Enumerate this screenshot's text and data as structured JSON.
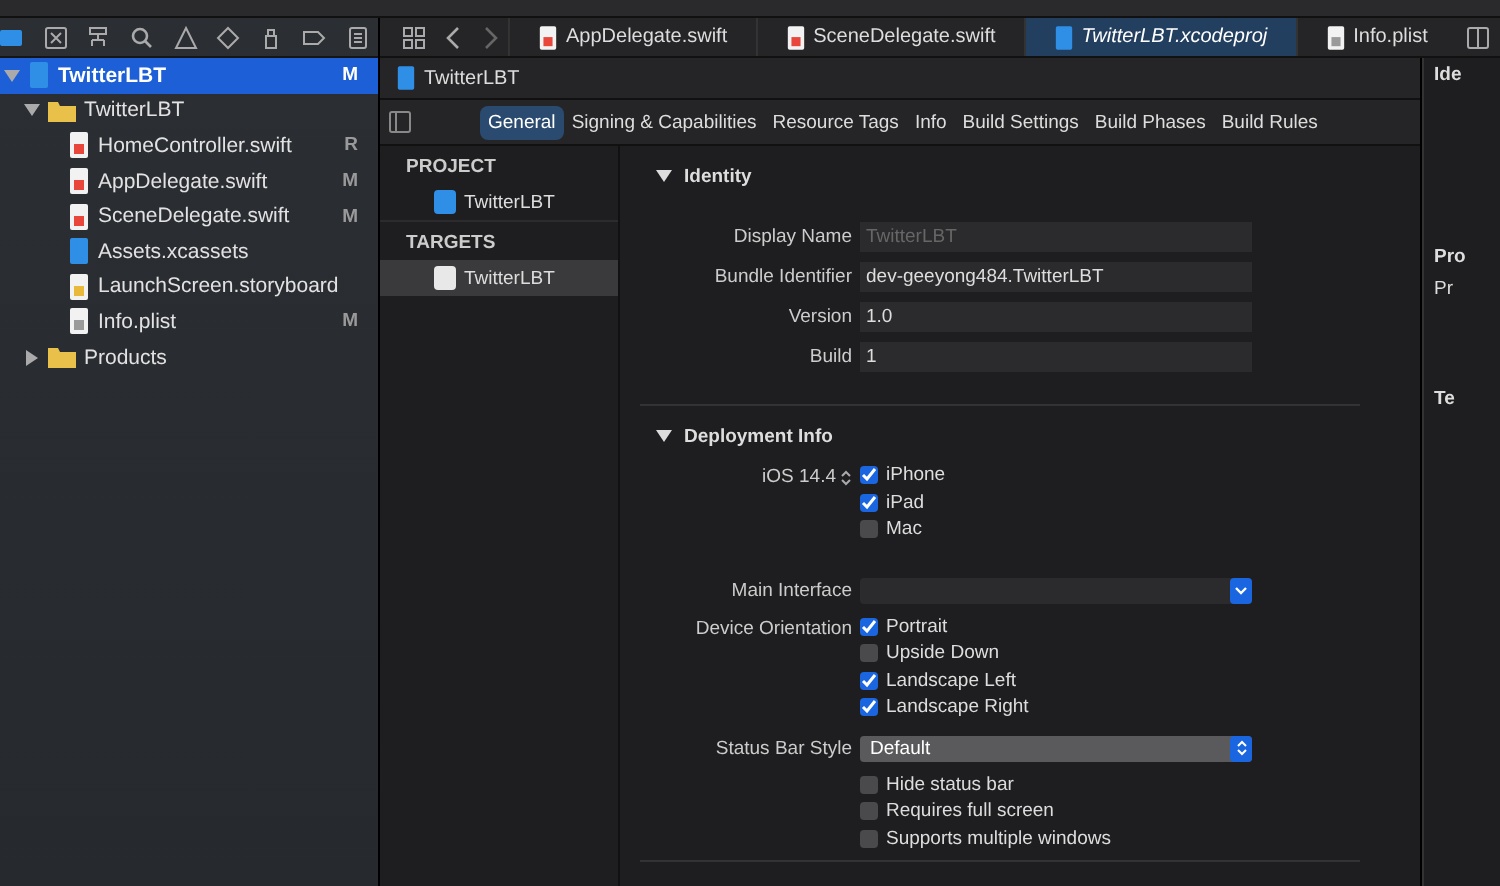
{
  "navigator": {
    "tree": [
      {
        "name": "TwitterLBT",
        "kind": "project",
        "badge": "M",
        "selected": true,
        "expanded": true,
        "children": [
          {
            "name": "TwitterLBT",
            "kind": "folder",
            "selected": false,
            "expanded": true,
            "children": [
              {
                "name": "HomeController.swift",
                "kind": "swift",
                "badge": "R",
                "selected": false
              },
              {
                "name": "AppDelegate.swift",
                "kind": "swift",
                "badge": "M",
                "selected": false
              },
              {
                "name": "SceneDelegate.swift",
                "kind": "swift",
                "badge": "M",
                "selected": false
              },
              {
                "name": "Assets.xcassets",
                "kind": "assets",
                "selected": false
              },
              {
                "name": "LaunchScreen.storyboard",
                "kind": "storyboard",
                "selected": false
              },
              {
                "name": "Info.plist",
                "kind": "plist",
                "badge": "M",
                "selected": false
              }
            ]
          },
          {
            "name": "Products",
            "kind": "folder",
            "selected": false,
            "expanded": false
          }
        ]
      }
    ]
  },
  "editor_tabs": [
    {
      "label": "AppDelegate.swift",
      "kind": "swift",
      "selected": false
    },
    {
      "label": "SceneDelegate.swift",
      "kind": "swift",
      "selected": false
    },
    {
      "label": "TwitterLBT.xcodeproj",
      "kind": "project",
      "selected": true
    },
    {
      "label": "Info.plist",
      "kind": "plist",
      "selected": false
    }
  ],
  "jump_bar": {
    "label": "TwitterLBT"
  },
  "settings_tabs": [
    {
      "label": "General",
      "selected": true
    },
    {
      "label": "Signing & Capabilities",
      "selected": false
    },
    {
      "label": "Resource Tags",
      "selected": false
    },
    {
      "label": "Info",
      "selected": false
    },
    {
      "label": "Build Settings",
      "selected": false
    },
    {
      "label": "Build Phases",
      "selected": false
    },
    {
      "label": "Build Rules",
      "selected": false
    }
  ],
  "targets_list": [
    {
      "heading": "PROJECT",
      "items": [
        {
          "label": "TwitterLBT",
          "kind": "project",
          "selected": false
        }
      ]
    },
    {
      "heading": "TARGETS",
      "items": [
        {
          "label": "TwitterLBT",
          "kind": "app",
          "selected": true
        }
      ]
    }
  ],
  "identity": {
    "title": "Identity",
    "expanded": true,
    "fields": [
      {
        "label": "Display Name",
        "placeholder": "TwitterLBT"
      },
      {
        "label": "Bundle Identifier",
        "value": "dev-geeyong484.TwitterLBT"
      },
      {
        "label": "Version",
        "value": "1.0"
      },
      {
        "label": "Build",
        "value": "1"
      }
    ]
  },
  "deployment": {
    "title": "Deployment Info",
    "expanded": true,
    "ios_version": "iOS 14.4",
    "devices": [
      {
        "label": "iPhone",
        "checked": true
      },
      {
        "label": "iPad",
        "checked": true
      },
      {
        "label": "Mac",
        "checked": false
      }
    ],
    "main_interface": {
      "label": "Main Interface"
    },
    "device_orientation": {
      "label": "Device Orientation",
      "options": [
        {
          "label": "Portrait",
          "checked": true
        },
        {
          "label": "Upside Down",
          "checked": false
        },
        {
          "label": "Landscape Left",
          "checked": true
        },
        {
          "label": "Landscape Right",
          "checked": true
        }
      ]
    },
    "status_bar_style": {
      "label": "Status Bar Style",
      "value": "Default"
    },
    "options": [
      {
        "label": "Hide status bar",
        "checked": false
      },
      {
        "label": "Requires full screen",
        "checked": false
      },
      {
        "label": "Supports multiple windows",
        "checked": false
      }
    ]
  },
  "inspector": {
    "labels": [
      "Ide",
      "Pro",
      "Pr",
      "Te"
    ]
  }
}
